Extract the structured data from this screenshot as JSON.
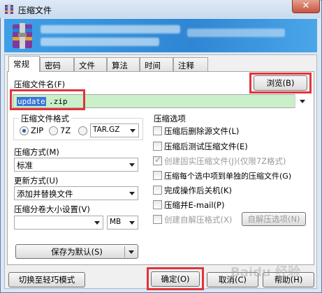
{
  "window": {
    "title": "压缩文件",
    "close_glyph": "✕"
  },
  "tabs": [
    "常规",
    "密码",
    "文件",
    "算法",
    "时间",
    "注释"
  ],
  "archive": {
    "name_label": "压缩文件名(F)",
    "browse_label": "浏览(B)",
    "name_selected": "update",
    "name_rest": ".zip"
  },
  "format": {
    "group_label": "压缩文件格式",
    "options": [
      "ZIP",
      "7Z",
      "TAR.GZ"
    ],
    "selected": "ZIP"
  },
  "method": {
    "label": "压缩方式(M)",
    "value": "标准"
  },
  "update_mode": {
    "label": "更新方式(U)",
    "value": "添加并替换文件"
  },
  "split": {
    "label": "压缩分卷大小设置(V)",
    "value": "",
    "unit": "MB"
  },
  "options": {
    "group_label": "压缩选项",
    "items": [
      {
        "label": "压缩后删除源文件(L)",
        "checked": false,
        "disabled": false
      },
      {
        "label": "压缩后测试压缩文件(E)",
        "checked": false,
        "disabled": false
      },
      {
        "label": "创建固实压缩文件(J)(仅限7Z格式)",
        "checked": true,
        "disabled": true
      },
      {
        "label": "压缩每个选中项到单独的压缩文件(G)",
        "checked": false,
        "disabled": false
      },
      {
        "label": "完成操作后关机(K)",
        "checked": false,
        "disabled": false
      },
      {
        "label": "压缩并E-mail(P)",
        "checked": false,
        "disabled": false
      },
      {
        "label": "创建自解压格式(X)",
        "checked": false,
        "disabled": true
      }
    ],
    "sfx_button": "自解压选项(N)"
  },
  "save_default": "保存为默认(S)",
  "footer": {
    "switch_mode": "切换至轻巧模式",
    "ok": "确定(O)",
    "cancel": "取消(C)",
    "help": "帮助(H)"
  },
  "watermark": "Baidu 经验",
  "colors": {
    "highlight_red": "#e0353a",
    "input_green": "#c9f0c9",
    "selection_blue": "#3875d7",
    "banner_blue": "#2f86d3"
  }
}
